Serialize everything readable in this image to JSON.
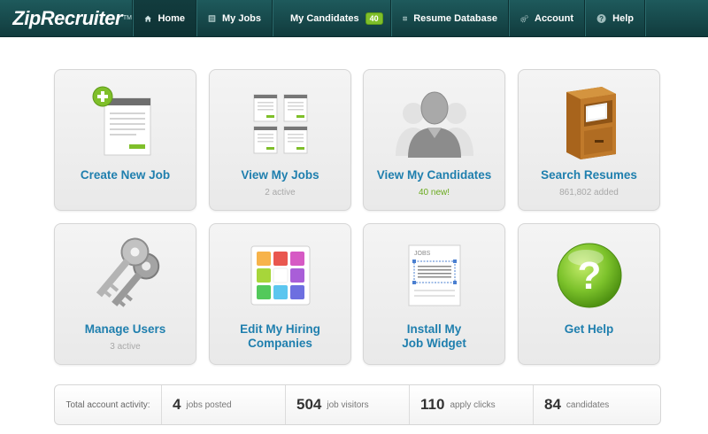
{
  "app": {
    "brand": "ZipRecruiter",
    "trademark": "TM"
  },
  "nav": {
    "home": "Home",
    "my_jobs": "My Jobs",
    "my_candidates": "My Candidates",
    "candidates_badge": "40",
    "resume_database": "Resume Database",
    "account": "Account",
    "help": "Help"
  },
  "tiles": {
    "create_job": {
      "title": "Create New Job"
    },
    "view_jobs": {
      "title": "View My Jobs",
      "sub": "2 active"
    },
    "view_candidates": {
      "title": "View My Candidates",
      "sub": "40 new!"
    },
    "search_resumes": {
      "title": "Search Resumes",
      "sub": "861,802 added"
    },
    "manage_users": {
      "title": "Manage Users",
      "sub": "3 active"
    },
    "edit_companies": {
      "title_line1": "Edit My Hiring",
      "title_line2": "Companies"
    },
    "install_widget": {
      "title_line1": "Install My",
      "title_line2": "Job Widget",
      "widget_label": "JOBS"
    },
    "get_help": {
      "title": "Get Help"
    }
  },
  "stats": {
    "label": "Total account activity:",
    "jobs_posted": {
      "value": "4",
      "label": "jobs posted"
    },
    "job_visitors": {
      "value": "504",
      "label": "job visitors"
    },
    "apply_clicks": {
      "value": "110",
      "label": "apply clicks"
    },
    "candidates": {
      "value": "84",
      "label": "candidates"
    }
  },
  "colors": {
    "nav_bg": "#174a4c",
    "accent_green": "#7fbf2a",
    "link_blue": "#1f7fae"
  },
  "icons": {
    "logo": "ziprecruiter-figure-icon",
    "home": "home-icon",
    "jobs": "list-icon",
    "candidates": "person-icon",
    "resumes": "database-icon",
    "account": "gears-icon",
    "help": "question-icon"
  }
}
